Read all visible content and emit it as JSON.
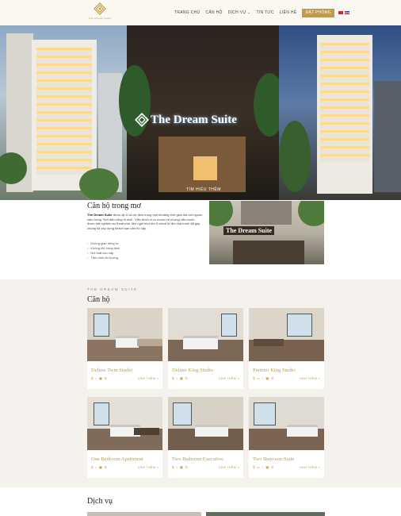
{
  "brand": {
    "logo_text": "The Dream Suite",
    "accent": "#c49a45"
  },
  "nav": {
    "items": [
      "TRANG CHỦ",
      "CĂN HỘ",
      "DỊCH VỤ ⌄",
      "TIN TỨC",
      "LIÊN HỆ"
    ],
    "book_label": "ĐẶT PHÒNG",
    "languages": [
      "vi-flag-icon",
      "en-flag-icon"
    ]
  },
  "hero": {
    "sign": "The Dream Suite",
    "cta": "TÌM HIỂU THÊM"
  },
  "intro": {
    "title": "Căn hộ trong mơ",
    "brand_bold": "The Dream Suite",
    "body": " được ấp ủ và dự định trong một khoảng thời gian dài với nguồn cảm hứng \"Nơi đâu cũng là nhà\". Việc thích vi vu muốn rơi nhưng vẫn muốn được trải nghiệm sự thoải mái, tiện nghi như khi ở chính từ ẩm của mình đã góp chúng tôi xây dựng khách sạn căn hộ này.",
    "features": [
      "Không gian riêng tư",
      "Không khí trong lành",
      "Nội thất cao cấp",
      "Tầm nhìn ấn tượng"
    ],
    "image_sign": "The Dream Suite"
  },
  "rooms": {
    "kicker": "THE DREAM SUITE",
    "title": "Căn hộ",
    "more_label": "XEM THÊM »",
    "items": [
      {
        "name": "Deluxe Twin Studio",
        "icons": "$ ⌂ ▣ ≋"
      },
      {
        "name": "Deluxe King Studio",
        "icons": "$ ⌂ ▣ ≋"
      },
      {
        "name": "Premier King Studio",
        "icons": "$ ▭ ⌂ ▣ ≋"
      },
      {
        "name": "One Bedroom Apartment",
        "icons": "$ ⌂ ▣ ≋"
      },
      {
        "name": "Two Bedroom Executive",
        "icons": "$ ⌂ ▣ ≋"
      },
      {
        "name": "Two Bedroom Suite",
        "icons": "$ ▭ ⌂ ▣ ≋"
      }
    ]
  },
  "services": {
    "title": "Dịch vụ"
  }
}
